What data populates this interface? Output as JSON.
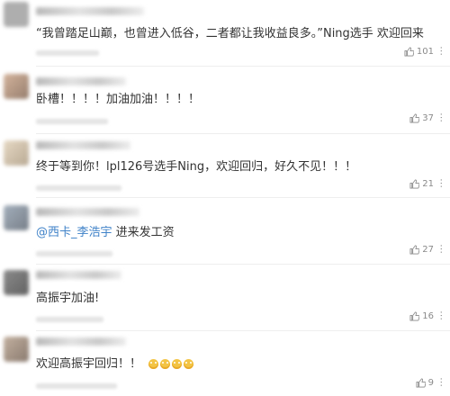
{
  "comments": [
    {
      "text": "“我曾踏足山巅，也曾进入低谷，二者都让我收益良多。”Ning选手 欢迎回来",
      "likes": "101",
      "avatar_color": "#9a9a9a"
    },
    {
      "text": "卧槽！！！！加油加油！！！！",
      "likes": "37",
      "avatar_color": "#b08a6e"
    },
    {
      "text": "终于等到你！lpl126号选手Ning，欢迎回归，好久不见！！！",
      "likes": "21",
      "avatar_color": "#c9b79c"
    },
    {
      "mention": "@西卡_李浩宇",
      "text": " 进来发工资",
      "likes": "27",
      "avatar_color": "#6f7d8c"
    },
    {
      "text": "高振宇加油!",
      "likes": "16",
      "avatar_color": "#5a5a5a"
    },
    {
      "text": "欢迎高振宇回归！！",
      "likes": "9",
      "avatar_color": "#8c7a6a",
      "emoji_count": 4
    }
  ],
  "icons": {
    "like": "thumbs-up-icon",
    "more": "more-options-icon"
  }
}
